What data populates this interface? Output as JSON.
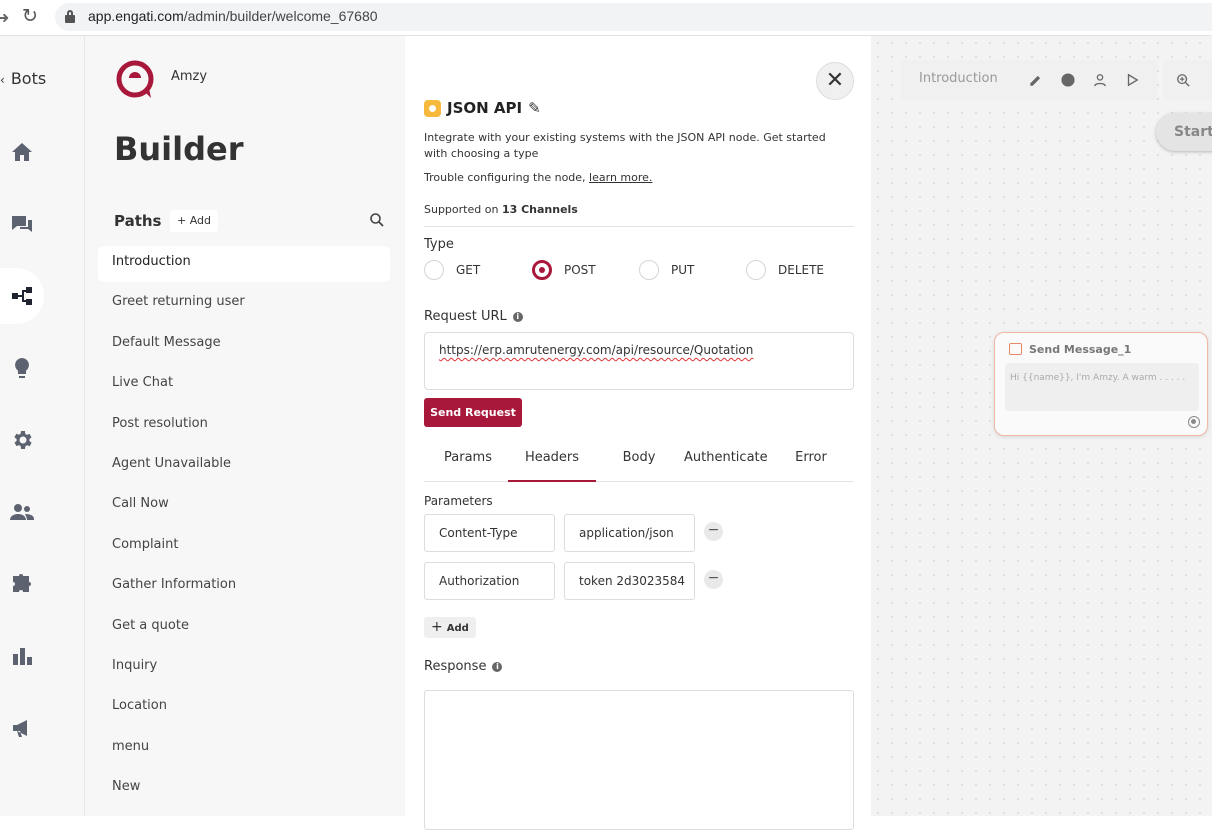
{
  "browser": {
    "url_host": "app.engati.com",
    "url_path": "/admin/builder/welcome_67680"
  },
  "rail": {
    "bots_label": "Bots",
    "icons": [
      "home-icon",
      "chat-icon",
      "builder-flow-icon",
      "bulb-icon",
      "gear-icon",
      "users-icon",
      "puzzle-icon",
      "bar-chart-icon",
      "megaphone-icon"
    ],
    "active": "builder-flow-icon"
  },
  "sidebar": {
    "bot_name": "Amzy",
    "title": "Builder",
    "paths_label": "Paths",
    "add_label": "+ Add",
    "paths": [
      "Introduction",
      "Greet returning user",
      "Default Message",
      "Live Chat",
      "Post resolution",
      "Agent Unavailable",
      "Call Now",
      "Complaint",
      "Gather Information",
      "Get a quote",
      "Inquiry",
      "Location",
      "menu",
      "New"
    ],
    "selected_path": "Introduction"
  },
  "node": {
    "title": "JSON API",
    "description": "Integrate with your existing systems with the JSON API node. Get started with choosing a type",
    "trouble_text": "Trouble configuring the node, ",
    "learn_more": "learn more.",
    "supported_prefix": "Supported on ",
    "supported_count": "13 Channels",
    "type_label": "Type",
    "types": [
      "GET",
      "POST",
      "PUT",
      "DELETE"
    ],
    "selected_type": "POST",
    "request_url_label": "Request URL",
    "request_url": "https://erp.amrutenergy.com/api/resource/Quotation",
    "send_request_label": "Send Request",
    "tabs": [
      "Params",
      "Headers",
      "Body",
      "Authenticate",
      "Error"
    ],
    "active_tab": "Headers",
    "parameters_label": "Parameters",
    "parameters": [
      {
        "key": "Content-Type",
        "value": "application/json"
      },
      {
        "key": "Authorization",
        "value": "token 2d3023584"
      }
    ],
    "add_label": "Add",
    "response_label": "Response",
    "response_value": ""
  },
  "canvas": {
    "path_name": "Introduction",
    "start_label": "Start",
    "message_node": {
      "title": "Send Message_1",
      "preview": "Hi {{name}}, I'm Amzy. A warm . . . . ."
    }
  },
  "colors": {
    "accent": "#a8183a",
    "canvas_bg": "#f3f3f3"
  }
}
